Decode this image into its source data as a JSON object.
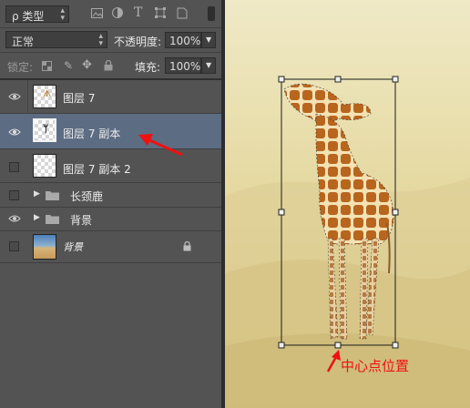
{
  "filter": {
    "kind_label": "ρ 类型",
    "icons": [
      "image-filter-icon",
      "adjustment-filter-icon",
      "type-filter-icon",
      "shape-filter-icon",
      "smart-object-filter-icon"
    ]
  },
  "blend": {
    "mode": "正常",
    "opacity_label": "不透明度:",
    "opacity_value": "100%"
  },
  "lock": {
    "label": "锁定:",
    "fill_label": "填充:",
    "fill_value": "100%"
  },
  "layers": [
    {
      "name": "图层 7",
      "visible": true,
      "selected": false,
      "type": "layer"
    },
    {
      "name": "图层 7 副本",
      "visible": true,
      "selected": true,
      "type": "layer"
    },
    {
      "name": "图层 7 副本 2",
      "visible": false,
      "selected": false,
      "type": "layer"
    },
    {
      "name": "长颈鹿",
      "visible": false,
      "selected": false,
      "type": "group"
    },
    {
      "name": "背景",
      "visible": true,
      "selected": false,
      "type": "group"
    },
    {
      "name": "背景",
      "visible": false,
      "selected": false,
      "type": "background",
      "locked": true
    }
  ],
  "annotation": {
    "center_label": "中心点位置",
    "color": "#ee1111"
  },
  "colors": {
    "panel": "#535353",
    "selected_row": "#5c6c82",
    "annotation": "#ee1111"
  }
}
